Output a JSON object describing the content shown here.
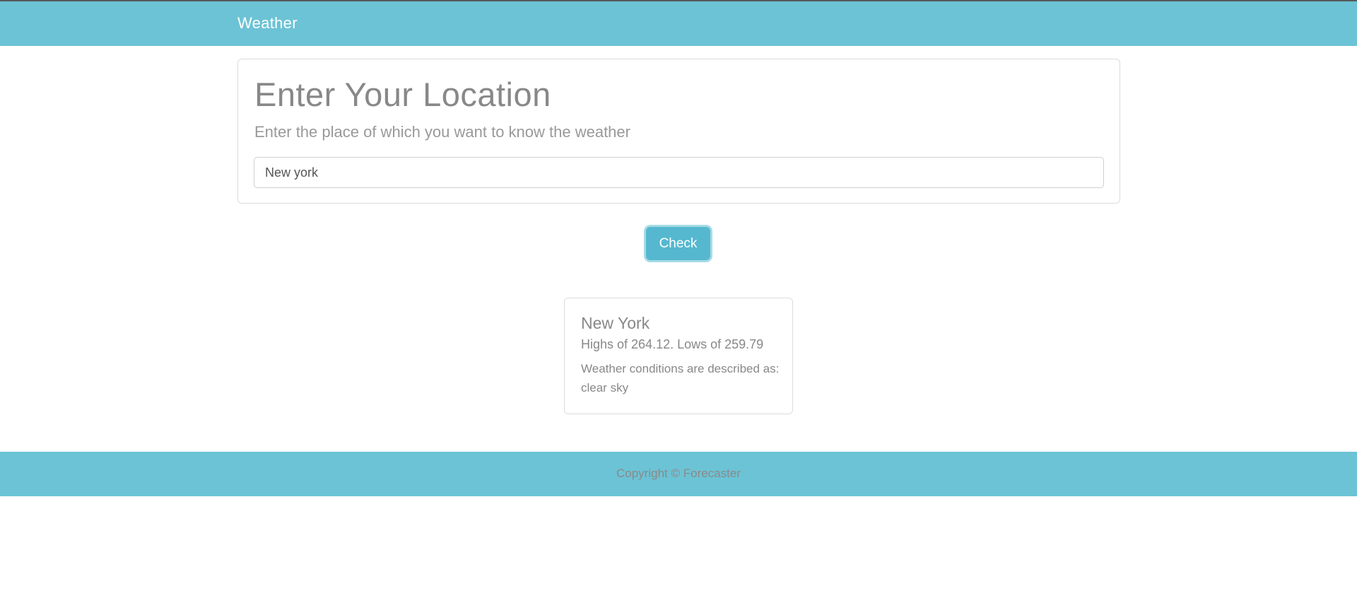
{
  "navbar": {
    "brand": "Weather"
  },
  "location_panel": {
    "title": "Enter Your Location",
    "subtitle": "Enter the place of which you want to know the weather",
    "input_value": "New york"
  },
  "actions": {
    "check_label": "Check"
  },
  "result": {
    "city": "New York",
    "temps": "Highs of 264.12. Lows of 259.79",
    "description": "Weather conditions are described as: clear sky"
  },
  "footer": {
    "text": "Copyright © Forecaster"
  },
  "colors": {
    "accent": "#6cc3d5",
    "button": "#55b8cf",
    "text_muted": "#888888"
  }
}
